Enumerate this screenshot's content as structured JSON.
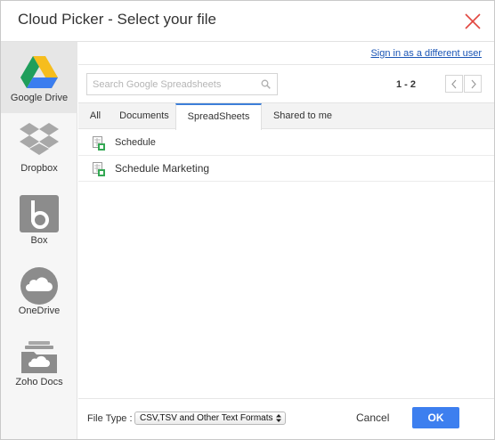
{
  "window": {
    "title": "Cloud Picker - Select your file"
  },
  "sidebar": {
    "items": [
      {
        "label": "Google Drive",
        "icon": "google-drive-icon",
        "active": true
      },
      {
        "label": "Dropbox",
        "icon": "dropbox-icon",
        "active": false
      },
      {
        "label": "Box",
        "icon": "box-icon",
        "active": false
      },
      {
        "label": "OneDrive",
        "icon": "onedrive-icon",
        "active": false
      },
      {
        "label": "Zoho Docs",
        "icon": "zoho-docs-icon",
        "active": false
      }
    ]
  },
  "header": {
    "sign_in_link": "Sign in as a different user"
  },
  "search": {
    "placeholder": "Search Google Spreadsheets",
    "value": ""
  },
  "pagination": {
    "range": "1 - 2"
  },
  "tabs": [
    {
      "label": "All"
    },
    {
      "label": "Documents"
    },
    {
      "label": "SpreadSheets",
      "active": true
    },
    {
      "label": "Shared to me"
    }
  ],
  "files": [
    {
      "name": "Schedule",
      "icon": "spreadsheet-icon"
    },
    {
      "name": "Schedule Marketing",
      "icon": "spreadsheet-icon"
    }
  ],
  "footer": {
    "file_type_label": "File Type :",
    "file_type_value": "CSV,TSV and Other Text Formats",
    "cancel_label": "Cancel",
    "ok_label": "OK"
  },
  "colors": {
    "accent": "#3d7fef",
    "link": "#1a55b5",
    "close": "#e2463f"
  }
}
